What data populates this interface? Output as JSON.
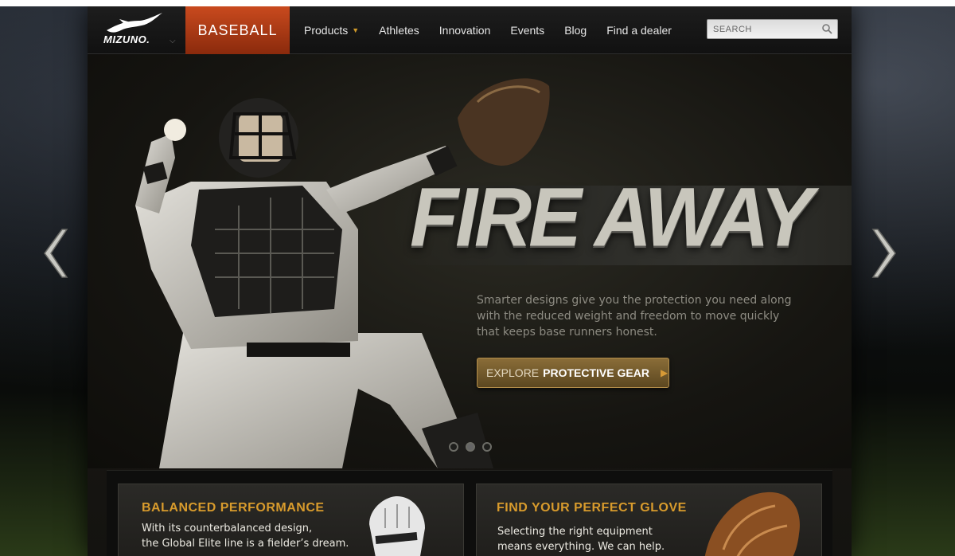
{
  "brand": {
    "name": "MIZUNO."
  },
  "header": {
    "sport_tab": "BASEBALL",
    "nav": [
      {
        "label": "Products",
        "has_dropdown": true
      },
      {
        "label": "Athletes"
      },
      {
        "label": "Innovation"
      },
      {
        "label": "Events"
      },
      {
        "label": "Blog"
      },
      {
        "label": "Find a dealer"
      }
    ],
    "search": {
      "placeholder": "SEARCH"
    }
  },
  "hero": {
    "headline": "FIRE AWAY",
    "body": "Smarter designs give you the protection you need along with the reduced weight and freedom to move quickly that keeps base runners honest.",
    "cta": {
      "prefix": "EXPLORE",
      "emphasis": "PROTECTIVE GEAR"
    },
    "slides": {
      "count": 3,
      "active": 2
    }
  },
  "features": [
    {
      "title": "BALANCED PERFORMANCE",
      "line1": "With its counterbalanced design,",
      "line2": "the Global Elite line is a fielder’s dream."
    },
    {
      "title": "FIND YOUR PERFECT GLOVE",
      "line1": "Selecting the right equipment",
      "line2": "means everything. We can help."
    }
  ],
  "colors": {
    "accent_orange": "#c94a1e",
    "gold": "#d89b2c",
    "cta_bronze": "#8a6d38"
  },
  "icons": {
    "prev": "chevron-left-icon",
    "next": "chevron-right-icon",
    "search": "search-icon",
    "cta": "play-triangle-icon"
  }
}
